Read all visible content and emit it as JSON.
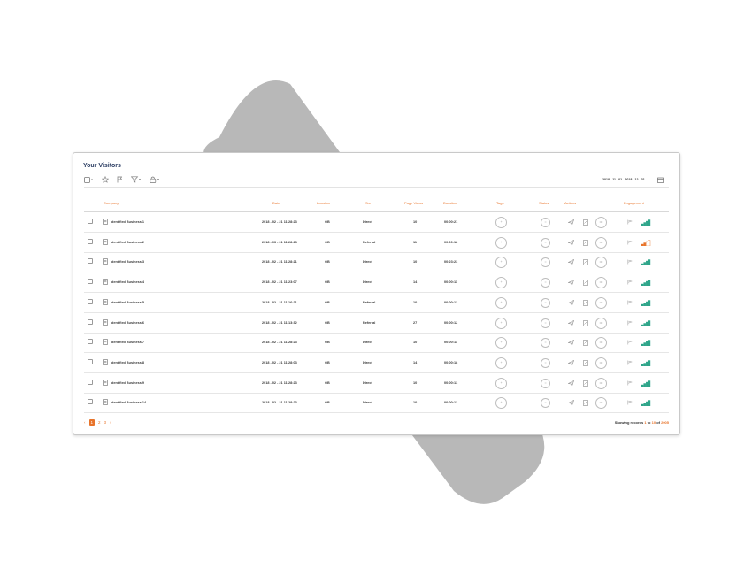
{
  "panel": {
    "title": "Your Visitors",
    "date_range": "2018 - 11 - 01 - 2018 - 12 - 31"
  },
  "toolbar": {
    "icons": [
      "checkbox-dropdown-icon",
      "star-icon",
      "flag-icon",
      "filter-dropdown-icon",
      "lock-dropdown-icon"
    ]
  },
  "table": {
    "columns": [
      "Company",
      "Date",
      "Location",
      "Src",
      "Page Views",
      "Duration",
      "Tags",
      "Status",
      "Actions",
      "Engagement"
    ],
    "rows": [
      {
        "company": "Identified Business 1",
        "date": "2018 - 02 - 21 11:28:23",
        "location": "GB",
        "src": "Direct",
        "views": "10",
        "duration": "00:00:21",
        "engagement": 4
      },
      {
        "company": "Identified Business 2",
        "date": "2018 - 03 - 01 11:28:23",
        "location": "GB",
        "src": "Referral",
        "views": "11",
        "duration": "00:00:12",
        "engagement": 2
      },
      {
        "company": "Identified Business 3",
        "date": "2018 - 02 - 21 11:28:21",
        "location": "GB",
        "src": "Direct",
        "views": "10",
        "duration": "00:23:23",
        "engagement": 4
      },
      {
        "company": "Identified Business 4",
        "date": "2018 - 02 - 21 11:23:07",
        "location": "GB",
        "src": "Direct",
        "views": "14",
        "duration": "00:00:11",
        "engagement": 4
      },
      {
        "company": "Identified Business 5",
        "date": "2018 - 02 - 21 11:16:21",
        "location": "GB",
        "src": "Referral",
        "views": "10",
        "duration": "00:00:13",
        "engagement": 4
      },
      {
        "company": "Identified Business 6",
        "date": "2018 - 02 - 21 11:13:32",
        "location": "GB",
        "src": "Referral",
        "views": "27",
        "duration": "00:00:12",
        "engagement": 4
      },
      {
        "company": "Identified Business 7",
        "date": "2018 - 02 - 21 11:28:23",
        "location": "GB",
        "src": "Direct",
        "views": "10",
        "duration": "00:00:11",
        "engagement": 4
      },
      {
        "company": "Identified Business 8",
        "date": "2018 - 02 - 21 11:28:03",
        "location": "GB",
        "src": "Direct",
        "views": "14",
        "duration": "00:00:18",
        "engagement": 4
      },
      {
        "company": "Identified Business 9",
        "date": "2018 - 02 - 21 11:28:23",
        "location": "GB",
        "src": "Direct",
        "views": "10",
        "duration": "00:00:13",
        "engagement": 4
      },
      {
        "company": "Identified Business 14",
        "date": "2018 - 02 - 21 11:28:23",
        "location": "GB",
        "src": "Direct",
        "views": "10",
        "duration": "00:00:13",
        "engagement": 4
      }
    ]
  },
  "pagination": {
    "prev": "‹",
    "pages": [
      "1",
      "2",
      "3"
    ],
    "active_page": "1",
    "next": "›"
  },
  "footer": {
    "showing_prefix": "Showing records",
    "from": "1",
    "to_word": "to",
    "to": "10",
    "of_word": "of",
    "total": "2005"
  },
  "colors": {
    "accent": "#e8742b",
    "title": "#2c3e63",
    "engagement_high": "#2ea58a",
    "engagement_low": "#e8742b",
    "backdrop": "#b8b8b8"
  }
}
